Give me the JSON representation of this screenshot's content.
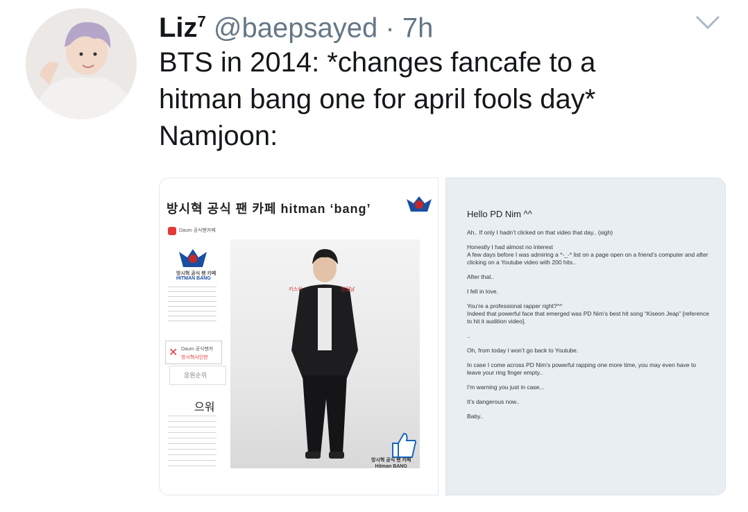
{
  "tweet": {
    "display_name": "Liz",
    "name_superscript": "7",
    "handle": "@baepsayed",
    "separator": "·",
    "time": "7h",
    "lines": [
      "BTS in 2014: *changes fancafe to a",
      "hitman bang one for april fools day*",
      "Namjoon:"
    ]
  },
  "left_image": {
    "cafe_title": "방시혁 공식 팬 카페 hitman ‘bang’",
    "daum_label": "Daum 공식팬카페",
    "logo_text": "HITMAN BANG",
    "cafe_name": "방시혁 공식 팬 카페",
    "cafe_name_en": "HITMAN BANG",
    "card_label": "Daum 공식팬카",
    "card_sub": "방시혁사인판",
    "rank_label": "응원순위",
    "uwo": "으워",
    "bottom_label_1": "방시혁 공식 팬 카페",
    "bottom_label_2": "Hitman BANG"
  },
  "letter": {
    "greeting": "Hello PD Nim ^^",
    "paragraphs": [
      "Ah.. If only I hadn’t clicked on that video that day.. (sigh)",
      "Honestly I had almost no interest\nA few days before I was admiring a *-_-* list on a page open on a friend’s computer and after clicking on a Youtube video with 200 hits..",
      "After that..",
      "I fell in love.",
      "You’re a professional rapper right?^^\nIndeed that powerful face that emerged was PD Nim’s best hit song “Kiseon Jeap” [reference to hit it audition video].",
      "..",
      "Oh, from today I won’t go back to Youtube.",
      "In case I come across PD Nim’s powerful rapping one more time, you may even have to leave your ring finger empty..",
      "I’m warning you just in case...",
      "It’s dangerous now..",
      "Baby.."
    ]
  },
  "colors": {
    "text": "#14171a",
    "secondary": "#657786",
    "logo_blue": "#1a4ea1",
    "logo_red": "#c62828"
  }
}
